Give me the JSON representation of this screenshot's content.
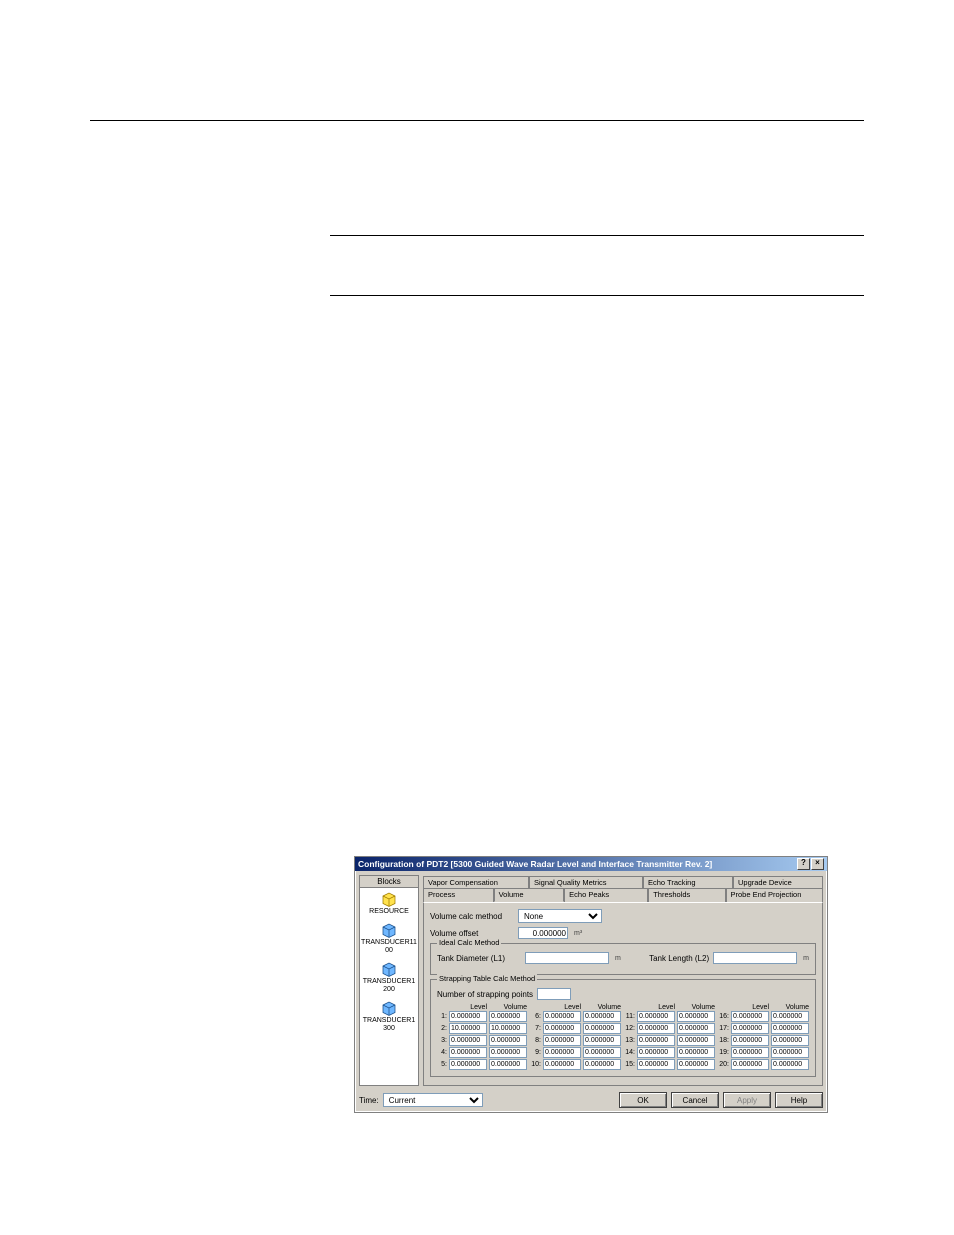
{
  "dialog": {
    "title": "Configuration of PDT2 [5300 Guided Wave Radar Level and Interface Transmitter Rev. 2]",
    "help_btn": "?",
    "close_btn": "×"
  },
  "blocks_panel": {
    "header": "Blocks",
    "items": [
      {
        "label": "RESOURCE",
        "color": "yellow"
      },
      {
        "label": "TRANSDUCER1100",
        "color": "blue"
      },
      {
        "label": "TRANSDUCER1200",
        "color": "blue"
      },
      {
        "label": "TRANSDUCER1300",
        "color": "blue"
      }
    ]
  },
  "tabs": {
    "row1": [
      "Vapor Compensation",
      "Signal Quality Metrics",
      "Echo Tracking",
      "Upgrade Device"
    ],
    "row2": [
      "Process",
      "Volume",
      "Echo Peaks",
      "Thresholds",
      "Probe End Projection"
    ],
    "active": "Volume"
  },
  "volume_tab": {
    "calc_method_label": "Volume calc method",
    "calc_method_value": "None",
    "offset_label": "Volume offset",
    "offset_value": "0.000000",
    "offset_unit": "m³"
  },
  "ideal_group": {
    "legend": "Ideal Calc Method",
    "diameter_label": "Tank Diameter (L1)",
    "diameter_value": "",
    "diameter_unit": "m",
    "length_label": "Tank Length (L2)",
    "length_value": "",
    "length_unit": "m"
  },
  "strap_group": {
    "legend": "Strapping Table Calc Method",
    "points_label": "Number of strapping points",
    "points_value": "",
    "col_level": "Level",
    "col_volume": "Volume",
    "rows": [
      {
        "i": "1",
        "level": "0.000000",
        "volume": "0.000000"
      },
      {
        "i": "2",
        "level": "10.00000",
        "volume": "10.00000"
      },
      {
        "i": "3",
        "level": "0.000000",
        "volume": "0.000000"
      },
      {
        "i": "4",
        "level": "0.000000",
        "volume": "0.000000"
      },
      {
        "i": "5",
        "level": "0.000000",
        "volume": "0.000000"
      },
      {
        "i": "6",
        "level": "0.000000",
        "volume": "0.000000"
      },
      {
        "i": "7",
        "level": "0.000000",
        "volume": "0.000000"
      },
      {
        "i": "8",
        "level": "0.000000",
        "volume": "0.000000"
      },
      {
        "i": "9",
        "level": "0.000000",
        "volume": "0.000000"
      },
      {
        "i": "10",
        "level": "0.000000",
        "volume": "0.000000"
      },
      {
        "i": "11",
        "level": "0.000000",
        "volume": "0.000000"
      },
      {
        "i": "12",
        "level": "0.000000",
        "volume": "0.000000"
      },
      {
        "i": "13",
        "level": "0.000000",
        "volume": "0.000000"
      },
      {
        "i": "14",
        "level": "0.000000",
        "volume": "0.000000"
      },
      {
        "i": "15",
        "level": "0.000000",
        "volume": "0.000000"
      },
      {
        "i": "16",
        "level": "0.000000",
        "volume": "0.000000"
      },
      {
        "i": "17",
        "level": "0.000000",
        "volume": "0.000000"
      },
      {
        "i": "18",
        "level": "0.000000",
        "volume": "0.000000"
      },
      {
        "i": "19",
        "level": "0.000000",
        "volume": "0.000000"
      },
      {
        "i": "20",
        "level": "0.000000",
        "volume": "0.000000"
      }
    ]
  },
  "footer": {
    "time_label": "Time:",
    "time_value": "Current",
    "ok": "OK",
    "cancel": "Cancel",
    "apply": "Apply",
    "help": "Help"
  }
}
